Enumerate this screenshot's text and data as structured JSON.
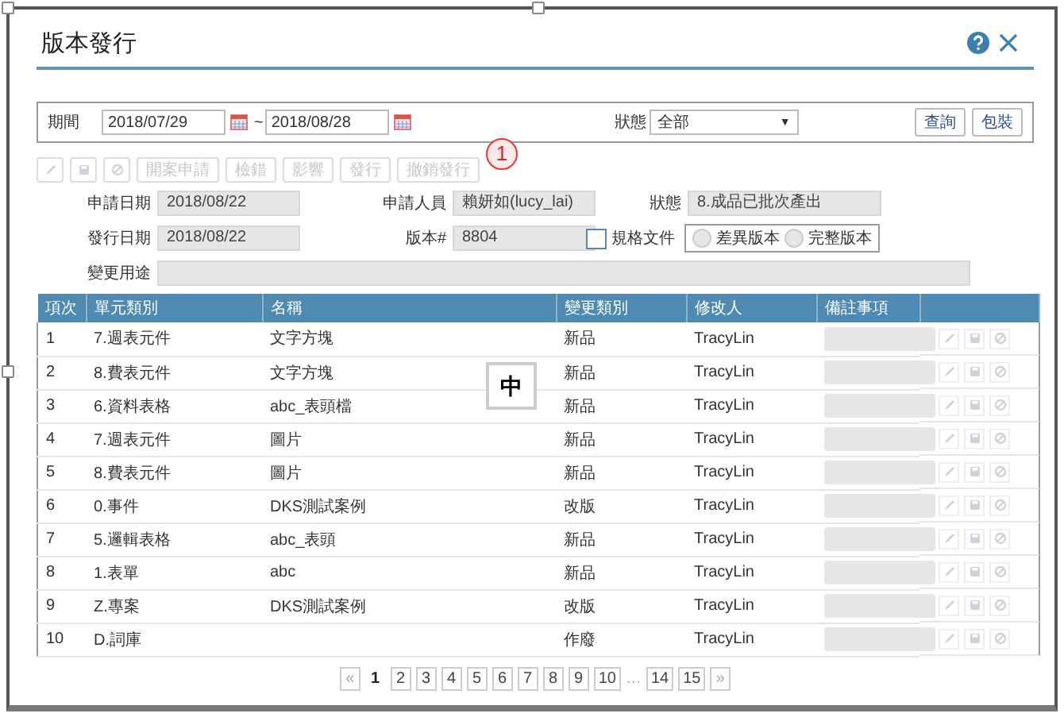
{
  "dialog": {
    "title": "版本發行"
  },
  "filter": {
    "period_label": "期間",
    "date_from": "2018/07/29",
    "separator": "~",
    "date_to": "2018/08/28",
    "status_label": "狀態",
    "status_value": "全部",
    "dropdown_arrow": "▼",
    "buttons": [
      "查詢",
      "包裝"
    ]
  },
  "toolbar": {
    "icon_buttons": [
      {
        "kind": "edit",
        "disabled": true
      },
      {
        "kind": "save",
        "disabled": true
      },
      {
        "kind": "cancel",
        "disabled": true
      }
    ],
    "buttons": [
      {
        "label": "開案申請",
        "disabled": true
      },
      {
        "label": "檢錯",
        "disabled": true
      },
      {
        "label": "影響",
        "disabled": true
      },
      {
        "label": "發行",
        "disabled": true
      },
      {
        "label": "撤銷發行",
        "disabled": true
      }
    ]
  },
  "annotation": {
    "label": "1"
  },
  "form": {
    "apply_date_label": "申請日期",
    "apply_date": "2018/08/22",
    "applicant_label": "申請人員",
    "applicant": "賴妍如(lucy_lai)",
    "status_label": "狀態",
    "status": "8.成品已批次產出",
    "release_date_label": "發行日期",
    "release_date": "2018/08/22",
    "version_label": "版本#",
    "version": "8804",
    "spec_doc": {
      "label": "規格文件",
      "checked": false
    },
    "version_types": [
      {
        "label": "差異版本",
        "selected": false
      },
      {
        "label": "完整版本",
        "selected": false
      }
    ],
    "purpose_label": "變更用途"
  },
  "table": {
    "columns": [
      "項次",
      "單元類別",
      "名稱",
      "變更類別",
      "修改人",
      "備註事項"
    ],
    "rows": [
      {
        "no": "1",
        "unit_type": "7.週表元件",
        "name": "文字方塊",
        "change_type": "新品",
        "modifier": "TracyLin"
      },
      {
        "no": "2",
        "unit_type": "8.費表元件",
        "name": "文字方塊",
        "change_type": "新品",
        "modifier": "TracyLin"
      },
      {
        "no": "3",
        "unit_type": "6.資料表格",
        "name": "abc_表頭檔",
        "change_type": "新品",
        "modifier": "TracyLin"
      },
      {
        "no": "4",
        "unit_type": "7.週表元件",
        "name": "圖片",
        "change_type": "新品",
        "modifier": "TracyLin"
      },
      {
        "no": "5",
        "unit_type": "8.費表元件",
        "name": "圖片",
        "change_type": "新品",
        "modifier": "TracyLin"
      },
      {
        "no": "6",
        "unit_type": "0.事件",
        "name": "DKS測試案例",
        "change_type": "改版",
        "modifier": "TracyLin"
      },
      {
        "no": "7",
        "unit_type": "5.邏輯表格",
        "name": "abc_表頭",
        "change_type": "新品",
        "modifier": "TracyLin"
      },
      {
        "no": "8",
        "unit_type": "1.表單",
        "name": "abc",
        "change_type": "新品",
        "modifier": "TracyLin"
      },
      {
        "no": "9",
        "unit_type": "Z.專案",
        "name": "DKS測試案例",
        "change_type": "改版",
        "modifier": "TracyLin"
      },
      {
        "no": "10",
        "unit_type": "D.詞庫",
        "change_type": "作廢",
        "modifier": "TracyLin"
      }
    ]
  },
  "pagination": {
    "prev": "«",
    "pages": [
      {
        "label": "1",
        "selected": true
      },
      {
        "label": "2",
        "selected": false
      },
      {
        "label": "3",
        "selected": false
      },
      {
        "label": "4",
        "selected": false
      },
      {
        "label": "5",
        "selected": false
      },
      {
        "label": "6",
        "selected": false
      },
      {
        "label": "7",
        "selected": false
      },
      {
        "label": "8",
        "selected": false
      },
      {
        "label": "9",
        "selected": false
      },
      {
        "label": "10",
        "selected": false
      },
      {
        "label": "…",
        "kind": "gap"
      },
      {
        "label": "14",
        "selected": false
      },
      {
        "label": "15",
        "selected": false
      }
    ],
    "next": "»"
  },
  "ime_indicator": {
    "label": "中"
  }
}
